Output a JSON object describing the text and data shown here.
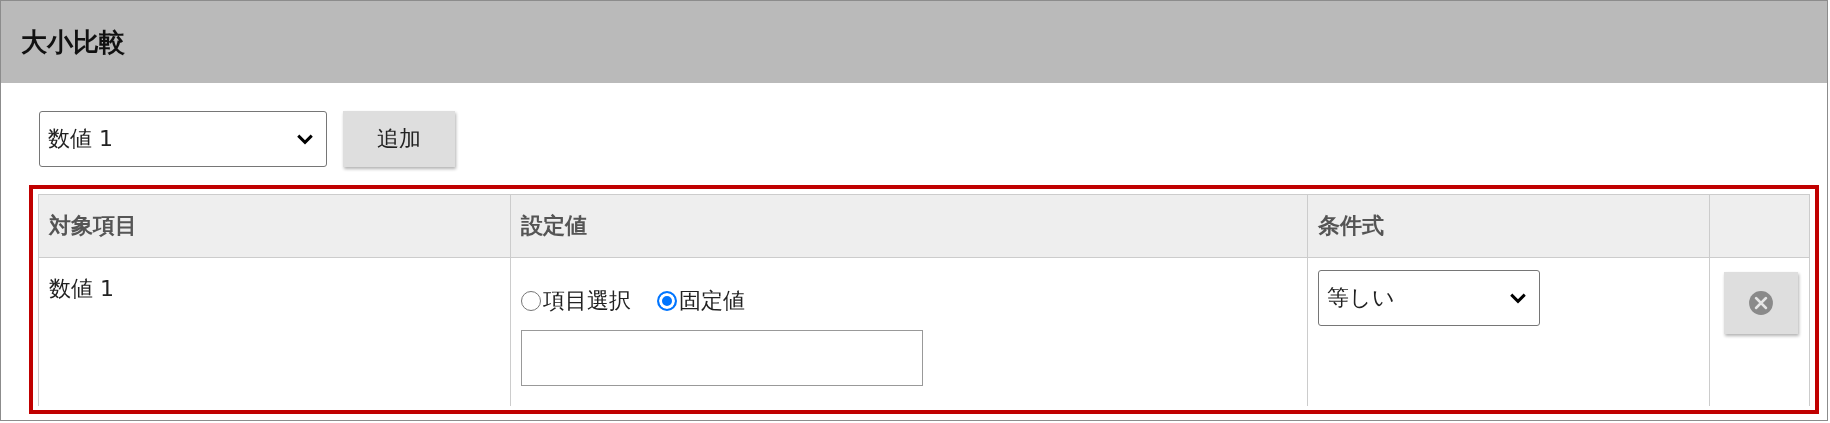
{
  "panel": {
    "title": "大小比較"
  },
  "add_bar": {
    "field_select": {
      "value": "数値 1"
    },
    "add_button": "追加"
  },
  "table": {
    "columns": [
      "対象項目",
      "設定値",
      "条件式"
    ],
    "rows": [
      {
        "target": "数値 1",
        "value_modes": [
          {
            "label": "項目選択",
            "selected": false
          },
          {
            "label": "固定値",
            "selected": true
          }
        ],
        "condition": {
          "value": "等しい"
        }
      }
    ]
  }
}
